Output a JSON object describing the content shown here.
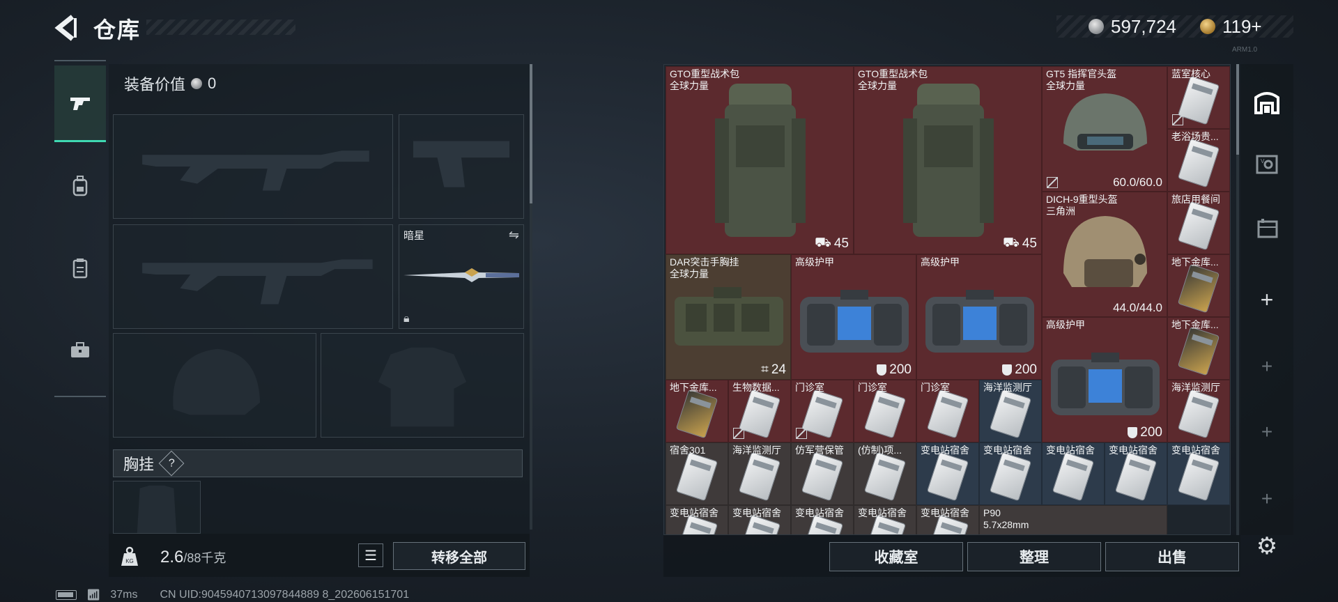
{
  "header": {
    "title": "仓库",
    "currency": [
      {
        "icon": "silver-coin-icon",
        "value": "597,724"
      },
      {
        "icon": "gold-coin-icon",
        "value": "119+"
      }
    ],
    "version": "ARM1.0"
  },
  "left_tabs": [
    {
      "icon": "gun-icon",
      "active": true
    },
    {
      "icon": "backpack-icon",
      "active": false
    },
    {
      "icon": "clipboard-icon",
      "active": false
    },
    {
      "icon": "toolbox-icon",
      "active": false
    }
  ],
  "loadout": {
    "equip_value_label": "装备价值",
    "equip_value": "0",
    "melee_name": "暗星",
    "chest_rig_label": "胸挂",
    "chest_rig_help": "?",
    "weight_value": "2.6",
    "weight_capacity": "/88千克",
    "transfer_all": "转移全部"
  },
  "inventory": [
    {
      "name": "GTO重型战术包",
      "sub": "全球力量",
      "badge": "45",
      "bg": "red"
    },
    {
      "name": "GTO重型战术包",
      "sub": "全球力量",
      "badge": "45",
      "bg": "red"
    },
    {
      "name": "GT5 指挥官头盔",
      "sub": "全球力量",
      "durability": "60.0/60.0",
      "bg": "red"
    },
    {
      "name": "蓝室核心",
      "bg": "red"
    },
    {
      "name": "老浴场贵...",
      "bg": "red"
    },
    {
      "name": "DICH-9重型头盔",
      "sub": "三角洲",
      "durability": "44.0/44.0",
      "bg": "red"
    },
    {
      "name": "旅店用餐间",
      "bg": "red"
    },
    {
      "name": "DAR突击手胸挂",
      "sub": "全球力量",
      "badge": "24",
      "bg": "brown"
    },
    {
      "name": "高级护甲",
      "badge": "200",
      "bg": "red"
    },
    {
      "name": "高级护甲",
      "badge": "200",
      "bg": "red"
    },
    {
      "name": "地下金库...",
      "bg": "red"
    },
    {
      "name": "高级护甲",
      "badge": "200",
      "bg": "red"
    },
    {
      "name": "地下金库...",
      "bg": "red"
    },
    {
      "name": "地下金库...",
      "bg": "red"
    },
    {
      "name": "生物数据...",
      "bg": "red"
    },
    {
      "name": "门诊室",
      "bg": "red"
    },
    {
      "name": "门诊室",
      "bg": "red"
    },
    {
      "name": "门诊室",
      "bg": "red"
    },
    {
      "name": "海洋监测厅",
      "bg": "blue"
    },
    {
      "name": "海洋监测厅",
      "bg": "red"
    },
    {
      "name": "宿舍301",
      "bg": "gray"
    },
    {
      "name": "海洋监测厅",
      "bg": "gray"
    },
    {
      "name": "仿军营保管",
      "bg": "gray"
    },
    {
      "name": "(仿制)项...",
      "bg": "gray"
    },
    {
      "name": "变电站宿舍",
      "bg": "blue"
    },
    {
      "name": "变电站宿舍",
      "bg": "blue"
    },
    {
      "name": "变电站宿舍",
      "bg": "blue"
    },
    {
      "name": "变电站宿舍",
      "bg": "blue"
    },
    {
      "name": "变电站宿舍",
      "bg": "blue"
    },
    {
      "name": "变电站宿舍",
      "bg": "gray"
    },
    {
      "name": "变电站宿舍",
      "bg": "gray"
    },
    {
      "name": "变电站宿舍",
      "bg": "gray"
    },
    {
      "name": "变电站宿舍",
      "bg": "gray"
    },
    {
      "name": "变电站宿舍",
      "bg": "gray"
    },
    {
      "name": "P90",
      "sub": "5.7x28mm",
      "bg": "gray"
    }
  ],
  "bottom_buttons": {
    "collection": "收藏室",
    "organize": "整理",
    "sell": "出售"
  },
  "status_bar": {
    "ping": "37ms",
    "uid": "CN UID:9045940713097844889 8_202606151701"
  }
}
